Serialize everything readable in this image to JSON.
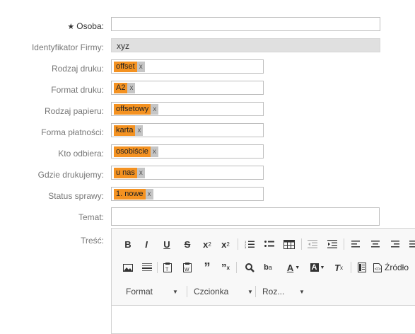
{
  "form": {
    "osoba": {
      "label": "Osoba:",
      "required_mark": "★",
      "value": ""
    },
    "identyfikator": {
      "label": "Identyfikator Firmy:",
      "value": "xyz"
    },
    "rodzaj_druku": {
      "label": "Rodzaj druku:",
      "tag": "offset",
      "remove": "x"
    },
    "format_druku": {
      "label": "Format druku:",
      "tag": "A2",
      "remove": "x"
    },
    "rodzaj_papieru": {
      "label": "Rodzaj papieru:",
      "tag": "offsetowy",
      "remove": "x"
    },
    "forma_platnosci": {
      "label": "Forma płatności:",
      "tag": "karta",
      "remove": "x"
    },
    "kto_odbiera": {
      "label": "Kto odbiera:",
      "tag": "osobiście",
      "remove": "x"
    },
    "gdzie_drukujemy": {
      "label": "Gdzie drukujemy:",
      "tag": "u nas",
      "remove": "x"
    },
    "status_sprawy": {
      "label": "Status sprawy:",
      "tag": "1. nowe",
      "remove": "x"
    },
    "temat": {
      "label": "Temat:",
      "value": ""
    },
    "tresc": {
      "label": "Treść:"
    }
  },
  "editor": {
    "toolbar_row1": [
      "bold-icon",
      "italic-icon",
      "underline-icon",
      "strikethrough-icon",
      "subscript-icon",
      "superscript-icon",
      "numbered-list-icon",
      "bulleted-list-icon",
      "table-icon",
      "outdent-icon",
      "indent-icon",
      "align-left-icon",
      "align-center-icon",
      "align-right-icon",
      "justify-icon"
    ],
    "source_label": "Źródło",
    "combos": {
      "format": "Format",
      "font": "Czcionka",
      "size": "Roz..."
    }
  }
}
